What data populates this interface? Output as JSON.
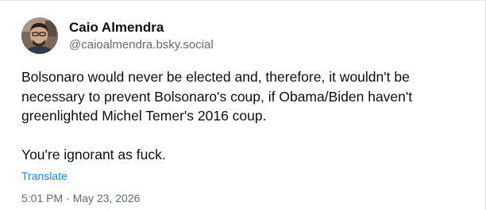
{
  "post": {
    "author": {
      "display_name": "Caio Almendra",
      "handle": "@caioalmendra.bsky.social",
      "avatar_icon": "user-avatar-photo"
    },
    "text": "Bolsonaro would never be elected and, therefore, it wouldn't be\nnecessary to prevent Bolsonaro's coup, if Obama/Biden haven't\ngreenlighted Michel Temer's 2016 coup.\n\nYou're ignorant as fuck.",
    "translate_label": "Translate",
    "timestamp": "5:01 PM · May 23, 2026"
  },
  "colors": {
    "link": "#1083fe",
    "muted": "#5f6b7a",
    "text": "#0b0f14"
  }
}
